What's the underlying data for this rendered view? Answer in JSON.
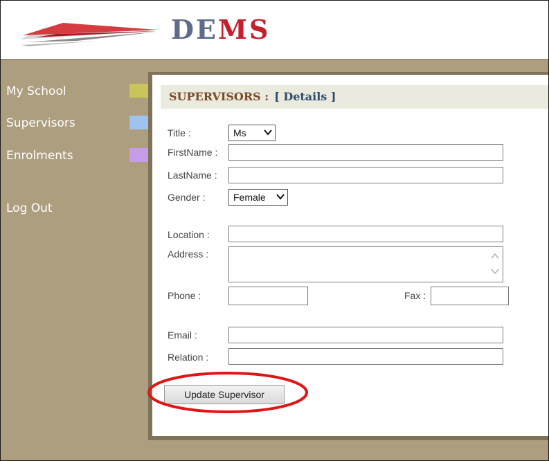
{
  "app": {
    "logo_text_a": "DE",
    "logo_text_b": "MS"
  },
  "sidebar": {
    "items": [
      {
        "label": "My School",
        "color": "#c9c55a"
      },
      {
        "label": "Supervisors",
        "color": "#9fc2ee"
      },
      {
        "label": "Enrolments",
        "color": "#c59ce8"
      }
    ],
    "logout_label": "Log Out"
  },
  "page": {
    "title": "SUPERVISORS :",
    "subtitle": "[ Details ]"
  },
  "form": {
    "title_label": "Title :",
    "title_value": "Ms",
    "firstname_label": "FirstName :",
    "firstname_value": "",
    "lastname_label": "LastName :",
    "lastname_value": "",
    "gender_label": "Gender :",
    "gender_value": "Female",
    "location_label": "Location :",
    "location_value": "",
    "address_label": "Address :",
    "address_value": "",
    "phone_label": "Phone :",
    "phone_value": "",
    "fax_label": "Fax :",
    "fax_value": "",
    "email_label": "Email :",
    "email_value": "",
    "relation_label": "Relation :",
    "relation_value": "",
    "submit_label": "Update Supervisor"
  },
  "annotation": {
    "highlight_color": "#e01515"
  }
}
